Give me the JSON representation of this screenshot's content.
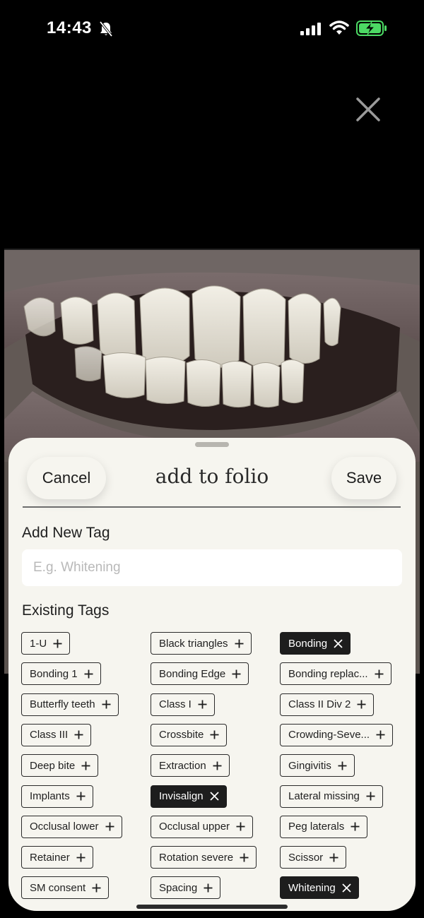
{
  "status_bar": {
    "time": "14:43",
    "icons": [
      "bell-slash-icon",
      "signal-icon",
      "wifi-icon",
      "battery-charging-icon"
    ],
    "battery_color": "#4cd964"
  },
  "photo": {
    "close_icon": "close-icon"
  },
  "sheet": {
    "cancel_label": "Cancel",
    "title": "add to folio",
    "save_label": "Save",
    "new_tag_label": "Add New Tag",
    "new_tag_placeholder": "E.g. Whitening",
    "new_tag_value": "",
    "existing_tags_label": "Existing Tags"
  },
  "tags": [
    {
      "label": "1-U",
      "selected": false
    },
    {
      "label": "Black triangles",
      "selected": false
    },
    {
      "label": "Bonding",
      "selected": true
    },
    {
      "label": "Bonding 1",
      "selected": false
    },
    {
      "label": "Bonding Edge",
      "selected": false
    },
    {
      "label": "Bonding replac...",
      "selected": false
    },
    {
      "label": "Butterfly teeth",
      "selected": false
    },
    {
      "label": "Class I",
      "selected": false
    },
    {
      "label": "Class II Div 2",
      "selected": false
    },
    {
      "label": "Class III",
      "selected": false
    },
    {
      "label": "Crossbite",
      "selected": false
    },
    {
      "label": "Crowding-Seve...",
      "selected": false
    },
    {
      "label": "Deep bite",
      "selected": false
    },
    {
      "label": "Extraction",
      "selected": false
    },
    {
      "label": "Gingivitis",
      "selected": false
    },
    {
      "label": "Implants",
      "selected": false
    },
    {
      "label": "Invisalign",
      "selected": true
    },
    {
      "label": "Lateral missing",
      "selected": false
    },
    {
      "label": "Occlusal lower",
      "selected": false
    },
    {
      "label": "Occlusal upper",
      "selected": false
    },
    {
      "label": "Peg laterals",
      "selected": false
    },
    {
      "label": "Retainer",
      "selected": false
    },
    {
      "label": "Rotation severe",
      "selected": false
    },
    {
      "label": "Scissor",
      "selected": false
    },
    {
      "label": "SM consent",
      "selected": false
    },
    {
      "label": "Spacing",
      "selected": false
    },
    {
      "label": "Whitening",
      "selected": true
    }
  ]
}
